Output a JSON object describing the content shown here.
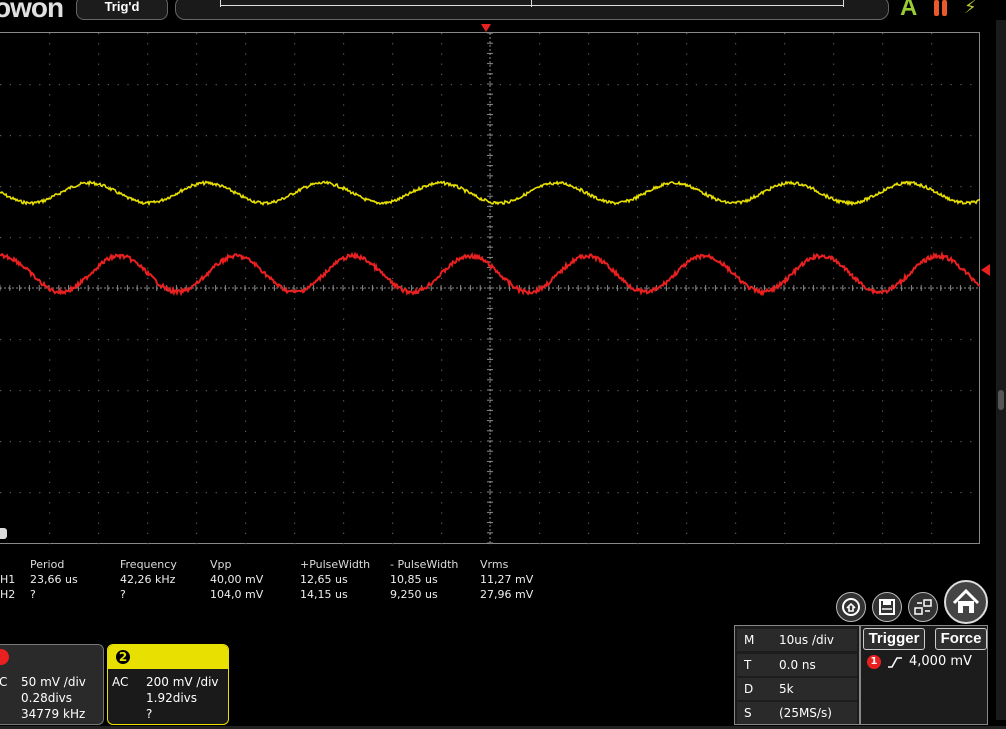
{
  "header": {
    "logo_text": "owon",
    "trigger_status": "Trig'd",
    "acquire_mode_letter": "A",
    "icons": [
      "run-pause-icon",
      "power-bolt-icon"
    ]
  },
  "colors": {
    "ch1": "#e8e000",
    "ch2": "#e82020",
    "grid": "#5a5a5a",
    "panel": "#2a2a2a"
  },
  "measurements": {
    "headers": [
      "Period",
      "Frequency",
      "Vpp",
      "+PulseWidth",
      "- PulseWidth",
      "Vrms"
    ],
    "rows": [
      {
        "label": "H1",
        "values": [
          "23,66 us",
          "42,26 kHz",
          "40,00 mV",
          "12,65 us",
          "10,85 us",
          "11,27 mV"
        ]
      },
      {
        "label": "H2",
        "values": [
          "?",
          "?",
          "104,0 mV",
          "14,15 us",
          "9,250 us",
          "27,96 mV"
        ]
      }
    ]
  },
  "ch1": {
    "coupling": "C",
    "scale": "50 mV /div",
    "offset": "0.28divs",
    "frequency": "34779 kHz"
  },
  "ch2": {
    "number": "2",
    "coupling": "AC",
    "scale": "200 mV /div",
    "offset": "1.92divs",
    "frequency": "?"
  },
  "timebase": {
    "rows": [
      {
        "key": "M",
        "value": "10us /div"
      },
      {
        "key": "T",
        "value": "0.0 ns"
      },
      {
        "key": "D",
        "value": "5k"
      },
      {
        "key": "S",
        "value": "(25MS/s)"
      }
    ]
  },
  "trigger_panel": {
    "trigger_label": "Trigger",
    "force_label": "Force",
    "source_number": "1",
    "level": "4,000 mV"
  },
  "bottom_icons": [
    "home-display-icon",
    "save-icon",
    "layout-icon",
    "home-icon"
  ]
}
